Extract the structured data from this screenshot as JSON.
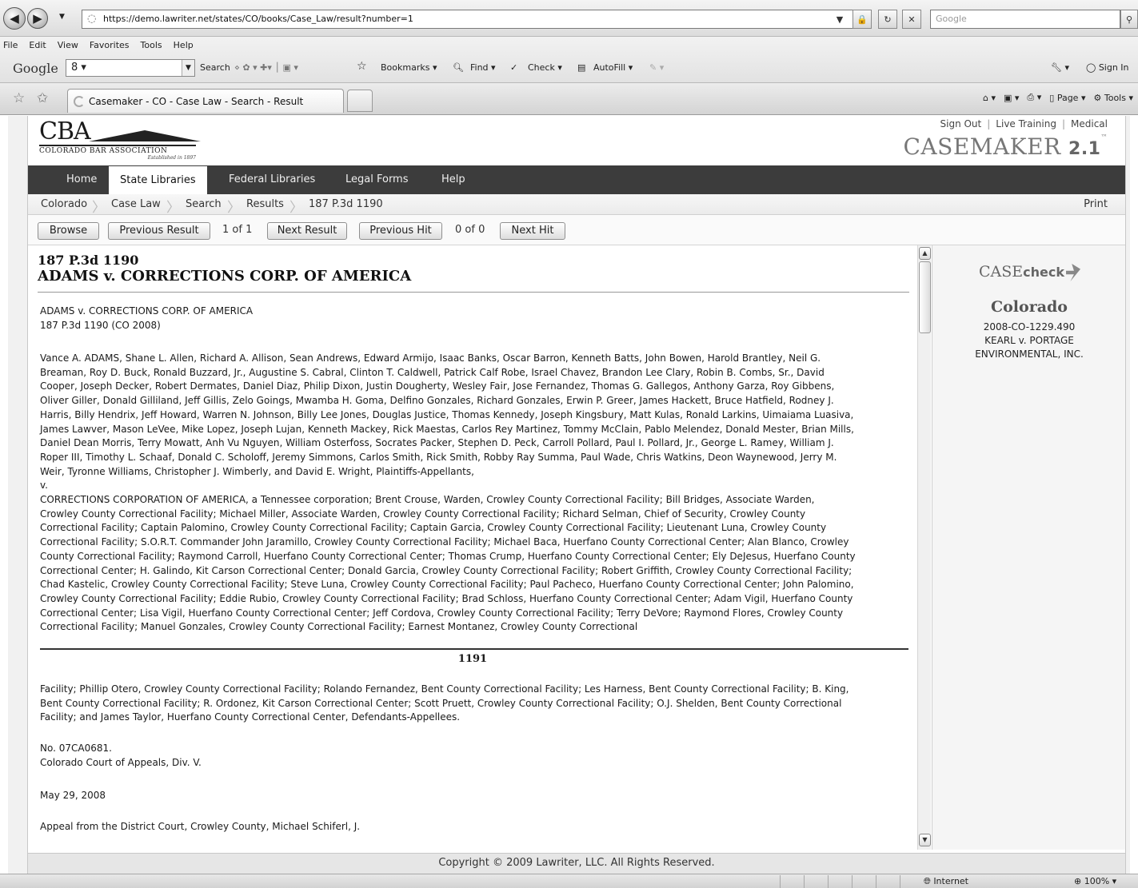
{
  "browser": {
    "url": "https://demo.lawriter.net/states/CO/books/Case_Law/result?number=1",
    "search_placeholder": "Google",
    "menu": [
      "File",
      "Edit",
      "View",
      "Favorites",
      "Tools",
      "Help"
    ],
    "google_toolbar": {
      "logo": "Google",
      "select_value": "8",
      "search": "Search",
      "bookmarks": "Bookmarks",
      "find": "Find",
      "check": "Check",
      "autofill": "AutoFill",
      "sign_in": "Sign In"
    },
    "tab_title": "Casemaker - CO - Case Law - Search - Result",
    "commands": {
      "page": "Page",
      "tools": "Tools"
    },
    "status": {
      "zone": "Internet",
      "zoom": "100%"
    }
  },
  "site": {
    "logo": {
      "letters": "CBA",
      "name": "COLORADO BAR ASSOCIATION",
      "established": "Established in 1897"
    },
    "top_links": [
      "Sign Out",
      "Live Training",
      "Medical"
    ],
    "brand": {
      "name": "CASEMAKER",
      "version": "2.1",
      "tm": "™"
    },
    "nav": [
      "Home",
      "State Libraries",
      "Federal Libraries",
      "Legal Forms",
      "Help"
    ],
    "breadcrumbs": [
      "Colorado",
      "Case Law",
      "Search",
      "Results",
      "187 P.3d 1190"
    ],
    "print": "Print",
    "result_bar": {
      "browse": "Browse",
      "prev_result": "Previous Result",
      "result_count": "1 of 1",
      "next_result": "Next Result",
      "prev_hit": "Previous Hit",
      "hit_count": "0 of 0",
      "next_hit": "Next Hit"
    },
    "footer": "Copyright © 2009 Lawriter, LLC. All Rights Reserved."
  },
  "document": {
    "citation": "187 P.3d 1190",
    "title": "ADAMS v. CORRECTIONS CORP. OF AMERICA",
    "header": "ADAMS v. CORRECTIONS CORP. OF AMERICA\n187 P.3d 1190 (CO 2008)",
    "plaintiffs": "Vance A. ADAMS, Shane L. Allen, Richard A. Allison, Sean Andrews, Edward Armijo, Isaac Banks, Oscar Barron, Kenneth Batts, John Bowen, Harold Brantley, Neil G.\nBreaman, Roy D. Buck, Ronald Buzzard, Jr., Augustine S. Cabral, Clinton T. Caldwell, Patrick Calf Robe, Israel Chavez, Brandon Lee Clary, Robin B. Combs, Sr., David\nCooper, Joseph Decker, Robert Dermates, Daniel Diaz, Philip Dixon, Justin Dougherty, Wesley Fair, Jose Fernandez, Thomas G. Gallegos, Anthony Garza, Roy Gibbens,\nOliver Giller, Donald Gilliland, Jeff Gillis, Zelo Goings, Mwamba H. Goma, Delfino Gonzales, Richard Gonzales, Erwin P. Greer, James Hackett, Bruce Hatfield, Rodney J.\nHarris, Billy Hendrix, Jeff Howard, Warren N. Johnson, Billy Lee Jones, Douglas Justice, Thomas Kennedy, Joseph Kingsbury, Matt Kulas, Ronald Larkins, Uimaiama Luasiva,\nJames Lawver, Mason LeVee, Mike Lopez, Joseph Lujan, Kenneth Mackey, Rick Maestas, Carlos Rey Martinez, Tommy McClain, Pablo Melendez, Donald Mester, Brian Mills,\nDaniel Dean Morris, Terry Mowatt, Anh Vu Nguyen, William Osterfoss, Socrates Packer, Stephen D. Peck, Carroll Pollard, Paul I. Pollard, Jr., George L. Ramey, William J.\nRoper III, Timothy L. Schaaf, Donald C. Scholoff, Jeremy Simmons, Carlos Smith, Rick Smith, Robby Ray Summa, Paul Wade, Chris Watkins, Deon Waynewood, Jerry M.\nWeir, Tyronne Williams, Christopher J. Wimberly, and David E. Wright, Plaintiffs-Appellants,\nv.\nCORRECTIONS CORPORATION OF AMERICA, a Tennessee corporation; Brent Crouse, Warden, Crowley County Correctional Facility; Bill Bridges, Associate Warden,\nCrowley County Correctional Facility; Michael Miller, Associate Warden, Crowley County Correctional Facility; Richard Selman, Chief of Security, Crowley County\nCorrectional Facility; Captain Palomino, Crowley County Correctional Facility; Captain Garcia, Crowley County Correctional Facility; Lieutenant Luna, Crowley County\nCorrectional Facility; S.O.R.T. Commander John Jaramillo, Crowley County Correctional Facility; Michael Baca, Huerfano County Correctional Center; Alan Blanco, Crowley\nCounty Correctional Facility; Raymond Carroll, Huerfano County Correctional Center; Thomas Crump, Huerfano County Correctional Center; Ely DeJesus, Huerfano County\nCorrectional Center; H. Galindo, Kit Carson Correctional Center; Donald Garcia, Crowley County Correctional Facility; Robert Griffith, Crowley County Correctional Facility;\nChad Kastelic, Crowley County Correctional Facility; Steve Luna, Crowley County Correctional Facility; Paul Pacheco, Huerfano County Correctional Center; John Palomino,\nCrowley County Correctional Facility; Eddie Rubio, Crowley County Correctional Facility; Brad Schloss, Huerfano County Correctional Center; Adam Vigil, Huerfano County\nCorrectional Center; Lisa Vigil, Huerfano County Correctional Center; Jeff Cordova, Crowley County Correctional Facility; Terry DeVore; Raymond Flores, Crowley County\nCorrectional Facility; Manuel Gonzales, Crowley County Correctional Facility; Earnest Montanez, Crowley County Correctional",
    "page_number": "1191",
    "continuation": "Facility; Phillip Otero, Crowley County Correctional Facility; Rolando Fernandez, Bent County Correctional Facility; Les Harness, Bent County Correctional Facility; B. King,\nBent County Correctional Facility; R. Ordonez, Kit Carson Correctional Center; Scott Pruett, Crowley County Correctional Facility; O.J. Shelden, Bent County Correctional\nFacility; and James Taylor, Huerfano County Correctional Center, Defendants-Appellees.",
    "docket": "No. 07CA0681.\nColorado Court of Appeals, Div. V.",
    "date": "May 29, 2008",
    "appeal": "Appeal from the District Court, Crowley County, Michael Schiferl, J."
  },
  "sidebar": {
    "casecheck_prefix": "CASE",
    "casecheck_suffix": "check",
    "state": "Colorado",
    "case_ref": "2008-CO-1229.490\nKEARL v. PORTAGE\nENVIRONMENTAL, INC."
  }
}
